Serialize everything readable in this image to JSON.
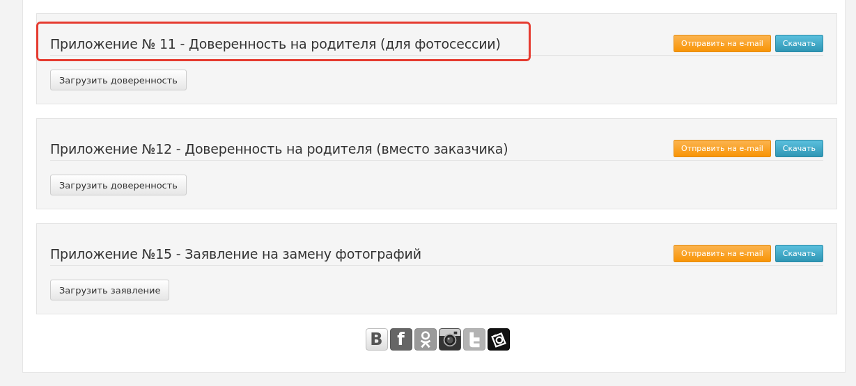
{
  "documents": [
    {
      "title": "Приложение № 11 - Доверенность на родителя (для фотосессии)",
      "highlighted": true,
      "email_button": "Отправить на e-mail",
      "download_button": "Скачать",
      "upload_button": "Загрузить доверенность"
    },
    {
      "title": "Приложение №12 - Доверенность на родителя (вместо заказчика)",
      "highlighted": false,
      "email_button": "Отправить на e-mail",
      "download_button": "Скачать",
      "upload_button": "Загрузить доверенность"
    },
    {
      "title": "Приложение №15 - Заявление на замену фотографий",
      "highlighted": false,
      "email_button": "Отправить на e-mail",
      "download_button": "Скачать",
      "upload_button": "Загрузить заявление"
    }
  ],
  "social_links": [
    {
      "kind": "vk",
      "glyph": "B"
    },
    {
      "kind": "facebook",
      "glyph": "f"
    },
    {
      "kind": "odnoklassniki"
    },
    {
      "kind": "instagram"
    },
    {
      "kind": "twitter"
    },
    {
      "kind": "photo"
    }
  ]
}
